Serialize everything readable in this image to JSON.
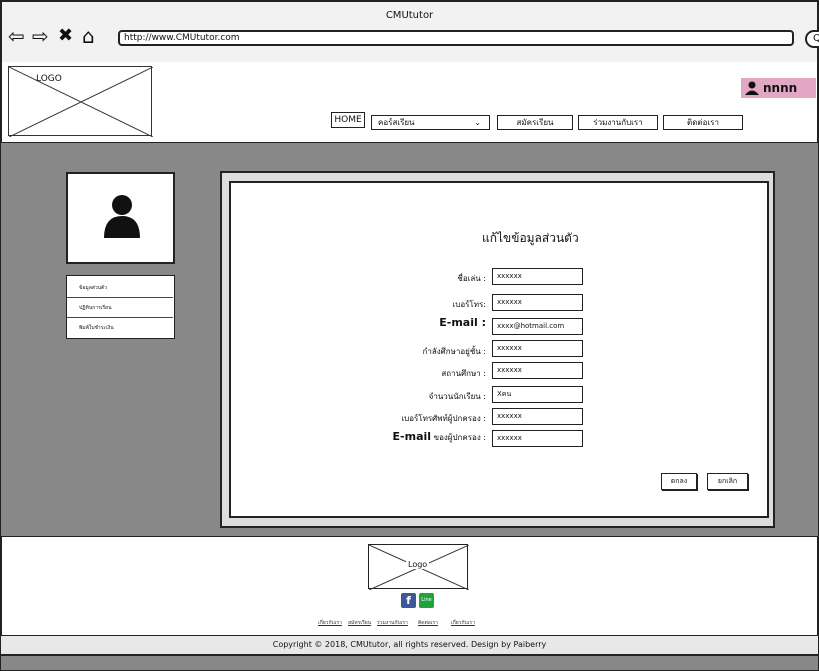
{
  "window": {
    "title": "CMUtutor"
  },
  "browser": {
    "url": "http://www.CMUtutor.com",
    "icons": [
      "back-arrow-icon",
      "forward-arrow-icon",
      "close-x-icon",
      "home-icon",
      "search-icon"
    ]
  },
  "header": {
    "logo": "LOGO",
    "user": "nnnn",
    "nav": [
      {
        "label": "HOME"
      },
      {
        "label": "คอร์สเรียน"
      },
      {
        "label": "สมัครเรียน"
      },
      {
        "label": "ร่วมงานกับเรา"
      },
      {
        "label": "ติดต่อเรา"
      }
    ]
  },
  "sidebar": {
    "items": [
      {
        "label": "ข้อมูลส่วนตัว"
      },
      {
        "label": "ปฏิทินการเรียน"
      },
      {
        "label": "พิมพ์ใบชำระเงิน"
      }
    ]
  },
  "form": {
    "title": "แก้ไขข้อมูลส่วนตัว",
    "fields": [
      {
        "label": "ชื่อเล่น :",
        "value": "xxxxxx"
      },
      {
        "label": "เบอร์โทร:",
        "value": "xxxxxx"
      },
      {
        "label": "E-mail :",
        "value": "xxxx@hotmail.com"
      },
      {
        "label": "กำลังศึกษาอยู่ชั้น :",
        "value": "xxxxxx"
      },
      {
        "label": "สถานศึกษา :",
        "value": "xxxxxx"
      },
      {
        "label": "จำนวนนักเรียน :",
        "value": "Xคน"
      },
      {
        "label": "เบอร์โทรศัพท์ผู้ปกครอง :",
        "value": "xxxxxx"
      },
      {
        "label_prefix": "E-mail",
        "label_suffix": "ของผู้ปกครอง :",
        "value": "xxxxxx"
      }
    ],
    "confirm": "ตกลง",
    "cancel": "ยกเลิก"
  },
  "footer": {
    "logo": "Logo",
    "line_icon_text": "Line",
    "links": [
      {
        "label": "เกี่ยวกับเรา"
      },
      {
        "label": "สมัครเรียน"
      },
      {
        "label": "ร่วมงานกับเรา"
      },
      {
        "label": "ติดต่อเรา"
      },
      {
        "label": "เกี่ยวกับเรา"
      }
    ],
    "copyright": "Copyright © 2018, CMUtutor, all rights reserved. Design by Paiberry"
  }
}
